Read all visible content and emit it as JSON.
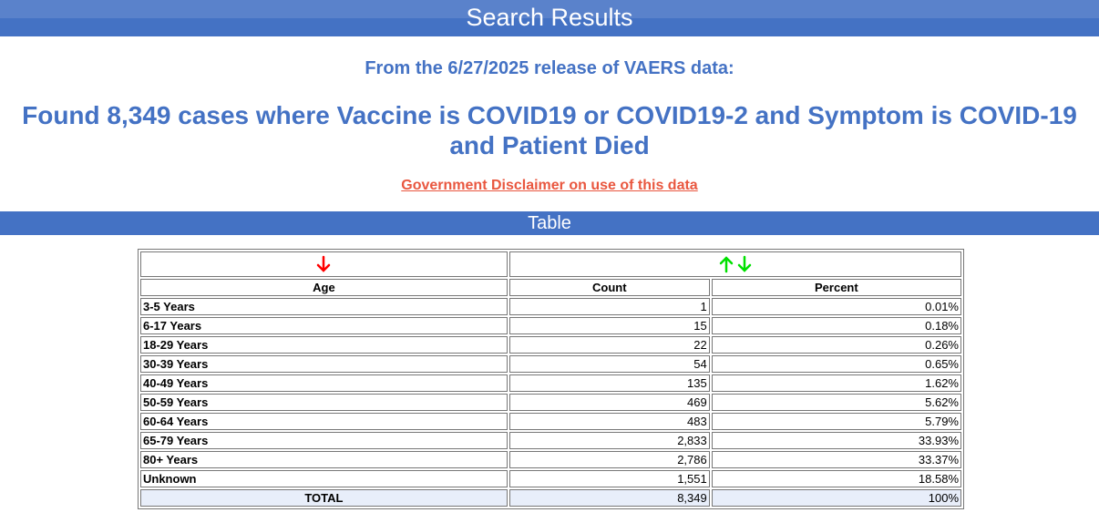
{
  "header": {
    "title": "Search Results"
  },
  "release_text": "From the 6/27/2025 release of VAERS data:",
  "found_text": "Found 8,349 cases where Vaccine is COVID19 or COVID19-2 and Symptom is COVID-19 and Patient Died",
  "disclaimer_link": "Government Disclaimer on use of this data",
  "section_title": "Table",
  "table": {
    "sort_icons": {
      "age_sort": {
        "icon": "arrow-down-icon",
        "color": "#ff0000"
      },
      "count_sort_up": {
        "icon": "arrow-up-icon",
        "color": "#00e000"
      },
      "count_sort_down": {
        "icon": "arrow-down-icon",
        "color": "#00e000"
      }
    },
    "headers": {
      "age": "Age",
      "count": "Count",
      "percent": "Percent"
    },
    "rows": [
      {
        "age": "3-5 Years",
        "count": "1",
        "percent": "0.01%"
      },
      {
        "age": "6-17 Years",
        "count": "15",
        "percent": "0.18%"
      },
      {
        "age": "18-29 Years",
        "count": "22",
        "percent": "0.26%"
      },
      {
        "age": "30-39 Years",
        "count": "54",
        "percent": "0.65%"
      },
      {
        "age": "40-49 Years",
        "count": "135",
        "percent": "1.62%"
      },
      {
        "age": "50-59 Years",
        "count": "469",
        "percent": "5.62%"
      },
      {
        "age": "60-64 Years",
        "count": "483",
        "percent": "5.79%"
      },
      {
        "age": "65-79 Years",
        "count": "2,833",
        "percent": "33.93%"
      },
      {
        "age": "80+ Years",
        "count": "2,786",
        "percent": "33.37%"
      },
      {
        "age": "Unknown",
        "count": "1,551",
        "percent": "18.58%"
      }
    ],
    "total": {
      "label": "TOTAL",
      "count": "8,349",
      "percent": "100%"
    }
  },
  "colors": {
    "accent": "#4472c4",
    "link": "#e9573f",
    "total_row_bg": "#e8eefa"
  }
}
